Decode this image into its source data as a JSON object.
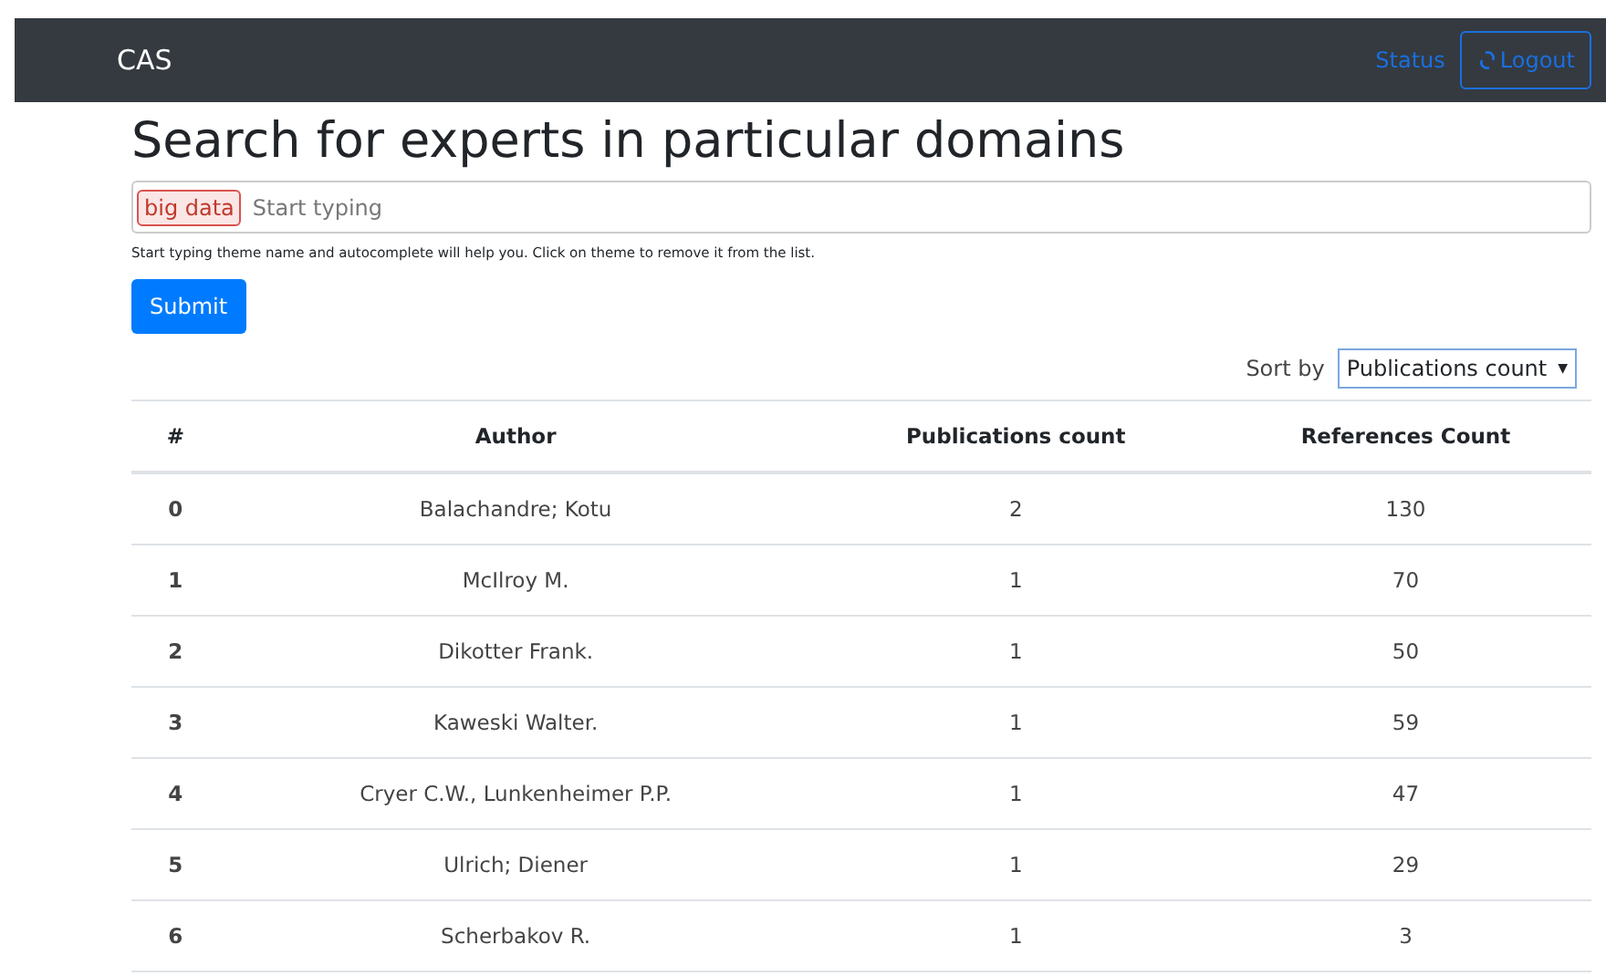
{
  "navbar": {
    "brand": "CAS",
    "links": [
      "Status"
    ],
    "logout": "Logout"
  },
  "title": "Search for experts in particular domains",
  "search": {
    "tags": [
      "big data"
    ],
    "placeholder": "Start typing",
    "help": "Start typing theme name and autocomplete will help you. Click on theme to remove it from the list."
  },
  "submit": "Submit",
  "sort": {
    "label": "Sort by",
    "value": "Publications count",
    "arrow": "▼"
  },
  "table": {
    "columns": [
      "#",
      "Author",
      "Publications count",
      "References Count"
    ],
    "rows": [
      [
        "0",
        "Balachandre; Kotu",
        "2",
        "130"
      ],
      [
        "1",
        "McIlroy M.",
        "1",
        "70"
      ],
      [
        "2",
        "Dikotter Frank.",
        "1",
        "50"
      ],
      [
        "3",
        "Kaweski Walter.",
        "1",
        "59"
      ],
      [
        "4",
        "Cryer C.W., Lunkenheimer P.P.",
        "1",
        "47"
      ],
      [
        "5",
        "Ulrich; Diener",
        "1",
        "29"
      ],
      [
        "6",
        "Scherbakov R.",
        "1",
        "3"
      ]
    ]
  }
}
